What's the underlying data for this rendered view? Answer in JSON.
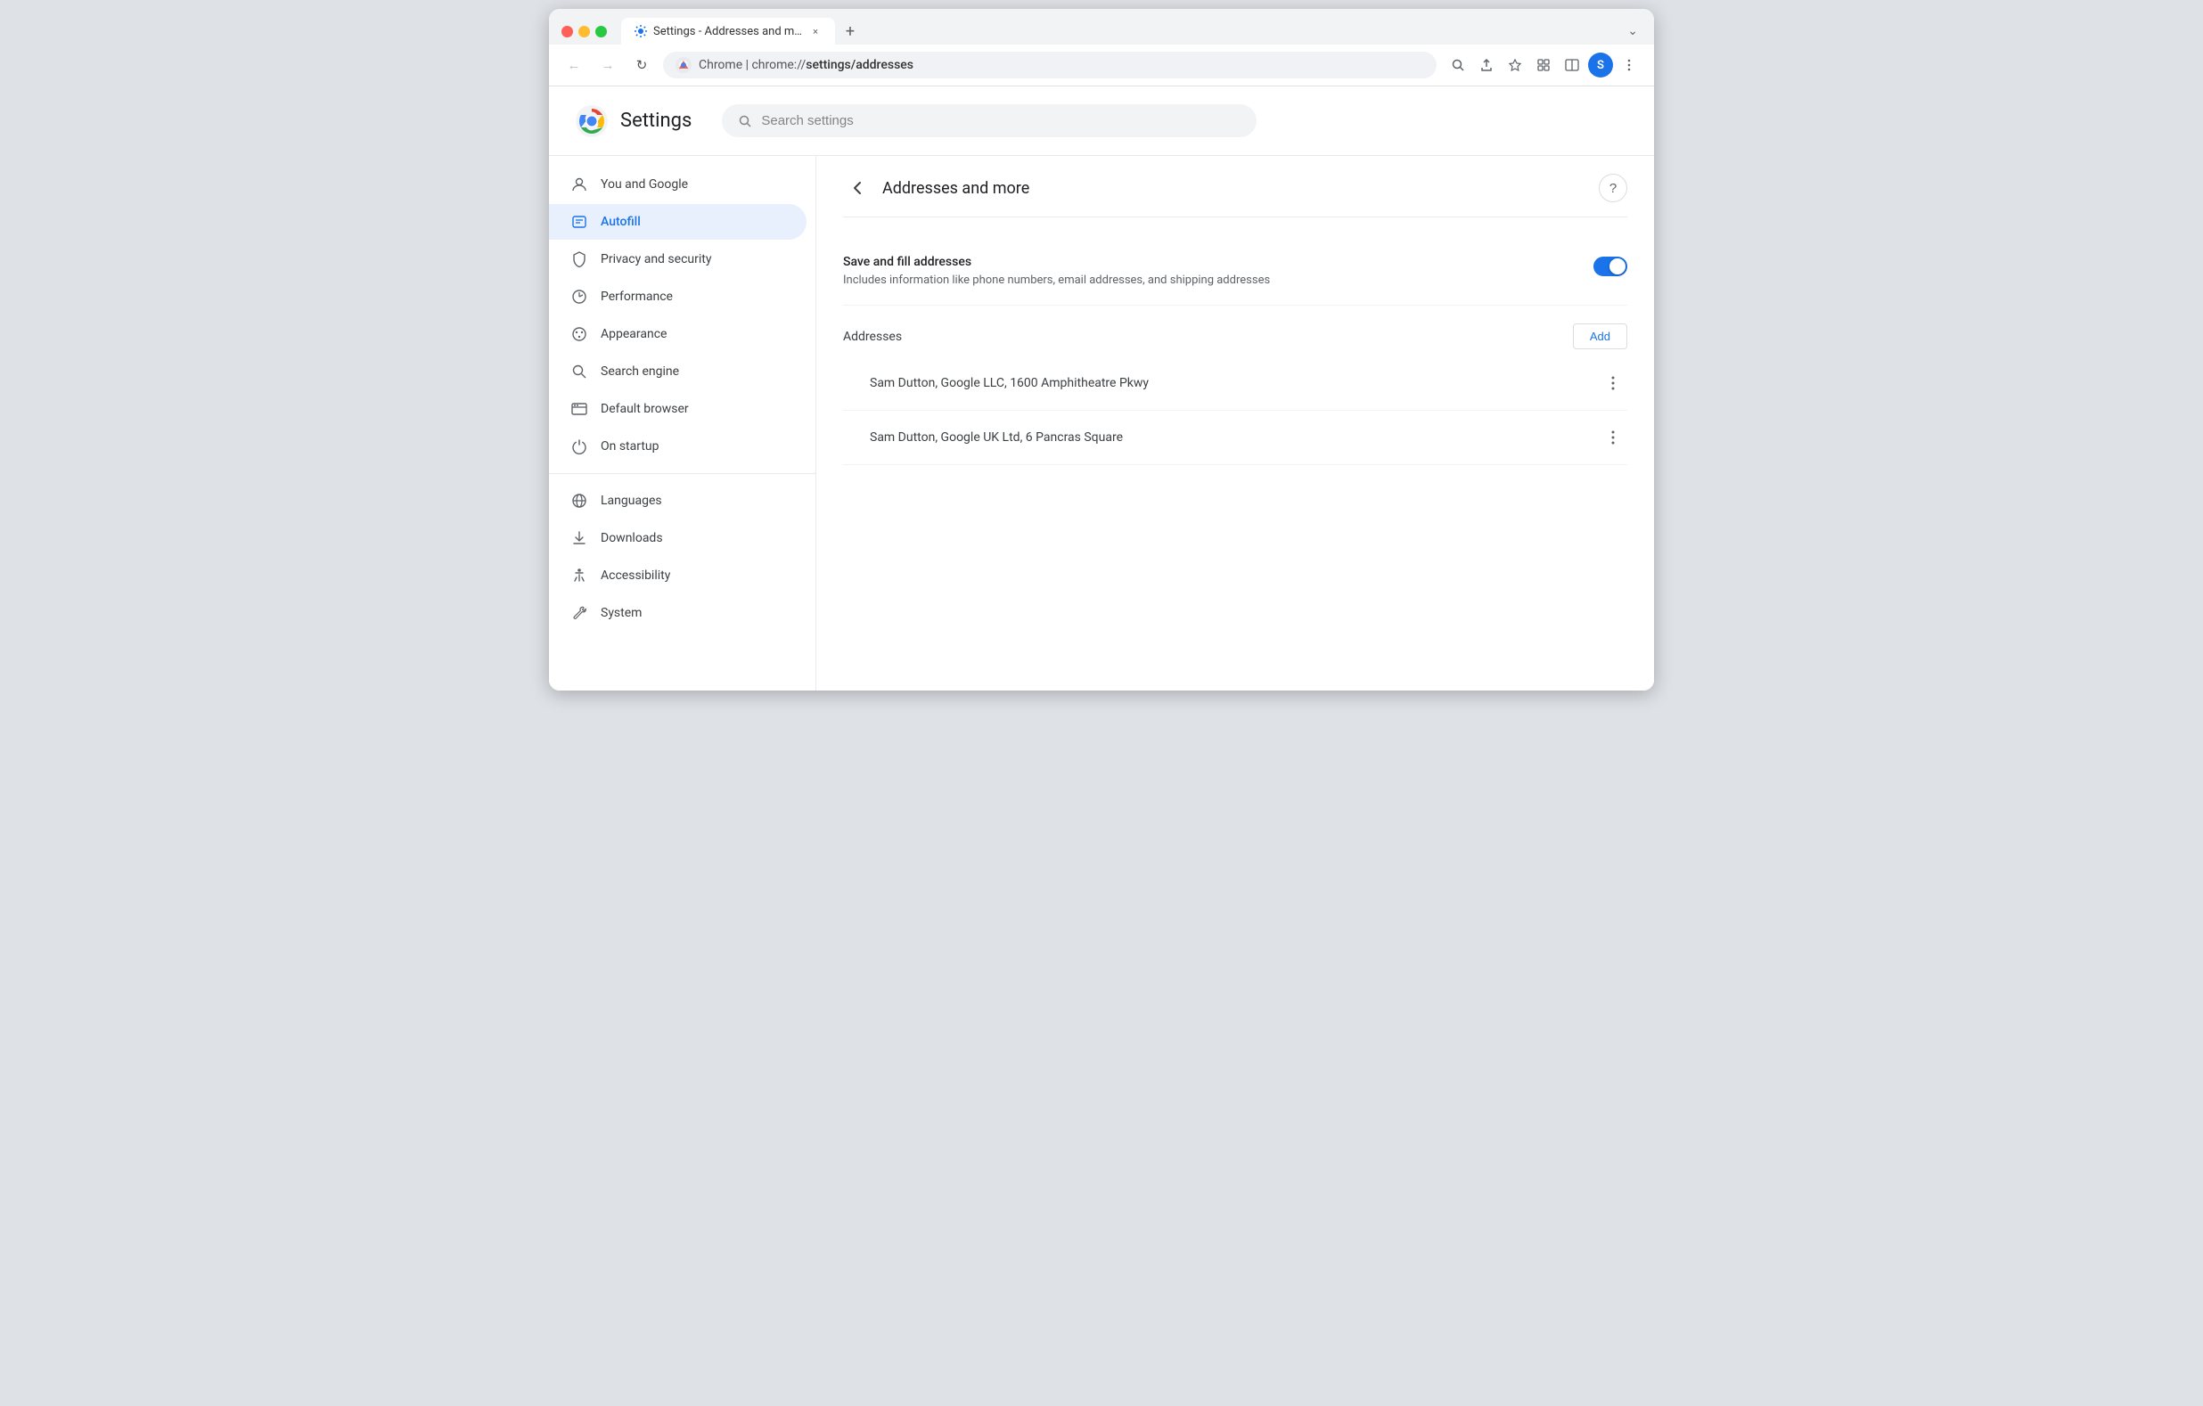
{
  "browser": {
    "tab": {
      "favicon_label": "settings-favicon",
      "title": "Settings - Addresses and more",
      "close_label": "×"
    },
    "new_tab_label": "+",
    "chevron_label": "⌄",
    "nav": {
      "back_label": "←",
      "forward_label": "→",
      "refresh_label": "↻",
      "address_domain": "Chrome  |  chrome://",
      "address_path": "settings/addresses",
      "magnify_label": "🔍",
      "share_label": "⬆",
      "bookmark_label": "☆",
      "extensions_label": "🧩",
      "split_label": "⧉",
      "profile_label": "S",
      "menu_label": "⋮"
    }
  },
  "settings": {
    "title": "Settings",
    "search_placeholder": "Search settings",
    "sidebar": {
      "items": [
        {
          "id": "you-and-google",
          "label": "You and Google",
          "icon": "person"
        },
        {
          "id": "autofill",
          "label": "Autofill",
          "icon": "autofill",
          "active": true
        },
        {
          "id": "privacy-security",
          "label": "Privacy and security",
          "icon": "shield"
        },
        {
          "id": "performance",
          "label": "Performance",
          "icon": "performance"
        },
        {
          "id": "appearance",
          "label": "Appearance",
          "icon": "palette"
        },
        {
          "id": "search-engine",
          "label": "Search engine",
          "icon": "magnify"
        },
        {
          "id": "default-browser",
          "label": "Default browser",
          "icon": "browser"
        },
        {
          "id": "on-startup",
          "label": "On startup",
          "icon": "power"
        }
      ],
      "items2": [
        {
          "id": "languages",
          "label": "Languages",
          "icon": "globe"
        },
        {
          "id": "downloads",
          "label": "Downloads",
          "icon": "download"
        },
        {
          "id": "accessibility",
          "label": "Accessibility",
          "icon": "accessibility"
        },
        {
          "id": "system",
          "label": "System",
          "icon": "wrench"
        }
      ]
    },
    "main": {
      "section_title": "Addresses and more",
      "back_label": "←",
      "help_label": "?",
      "toggle_setting": {
        "name": "Save and fill addresses",
        "description": "Includes information like phone numbers, email addresses, and shipping addresses",
        "enabled": true
      },
      "addresses_label": "Addresses",
      "add_button_label": "Add",
      "addresses": [
        {
          "id": "addr1",
          "text": "Sam Dutton, Google LLC, 1600 Amphitheatre Pkwy"
        },
        {
          "id": "addr2",
          "text": "Sam Dutton, Google UK Ltd, 6 Pancras Square"
        }
      ],
      "more_icon_label": "⋮"
    }
  }
}
